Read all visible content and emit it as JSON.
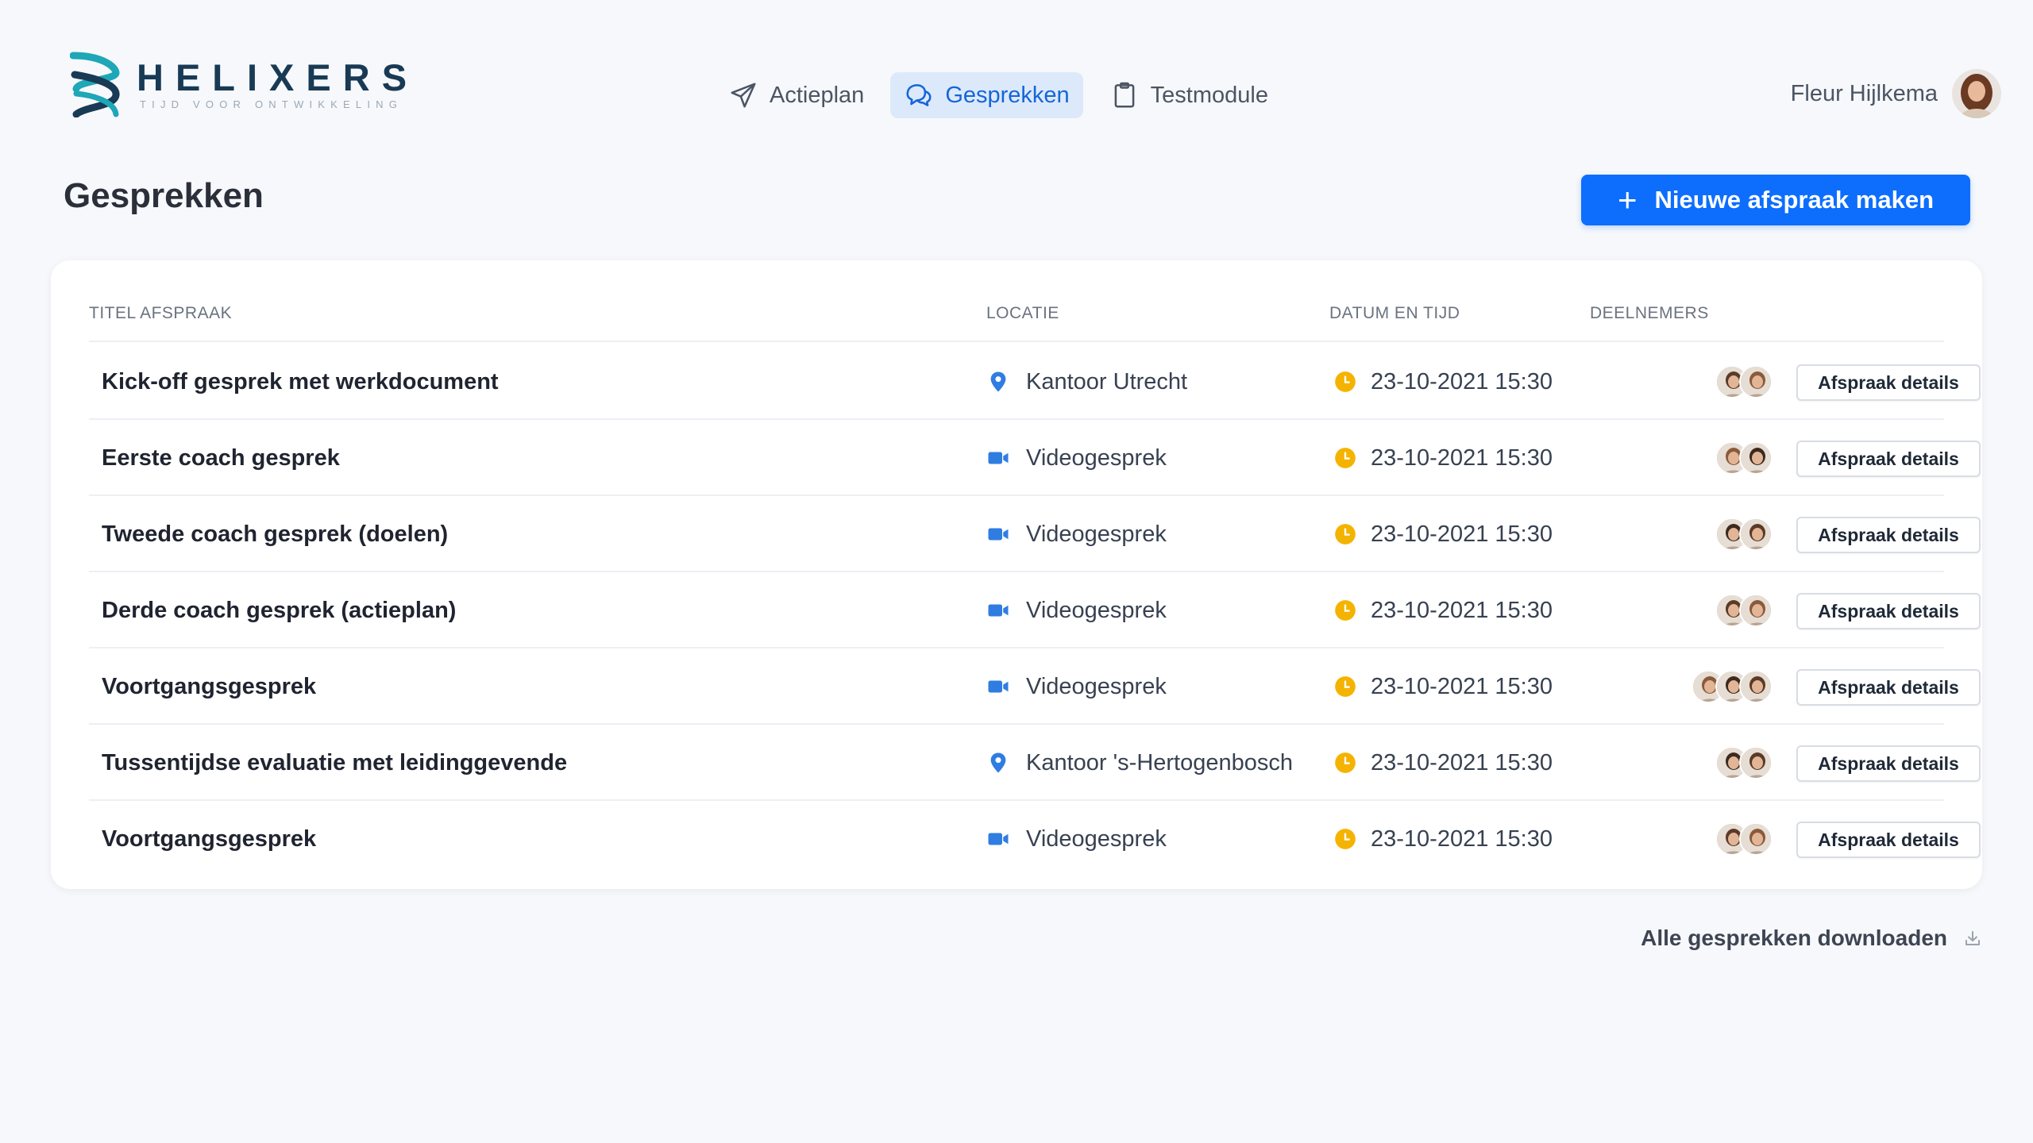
{
  "brand": {
    "name": "HELIXERS",
    "tagline": "TIJD VOOR ONTWIKKELING",
    "accent": "#0d6efd",
    "logo_teal": "#1ea7b7",
    "logo_navy": "#183a55"
  },
  "nav": {
    "items": [
      {
        "label": "Actieplan",
        "icon": "paper-plane-icon",
        "active": false
      },
      {
        "label": "Gesprekken",
        "icon": "chat-bubbles-icon",
        "active": true
      },
      {
        "label": "Testmodule",
        "icon": "clipboard-icon",
        "active": false
      }
    ]
  },
  "user": {
    "name": "Fleur Hijlkema"
  },
  "page": {
    "title": "Gesprekken",
    "new_button": "Nieuwe afspraak maken"
  },
  "table": {
    "headers": {
      "title": "TITEL AFSPRAAK",
      "location": "LOCATIE",
      "datetime": "DATUM EN TIJD",
      "participants": "DEELNEMERS"
    },
    "rows": [
      {
        "title": "Kick-off gesprek met werkdocument",
        "location": "Kantoor Utrecht",
        "location_type": "office",
        "datetime": "23-10-2021 15:30",
        "participants": 2,
        "action": "Afspraak details"
      },
      {
        "title": "Eerste coach gesprek",
        "location": "Videogesprek",
        "location_type": "video",
        "datetime": "23-10-2021 15:30",
        "participants": 2,
        "action": "Afspraak details"
      },
      {
        "title": "Tweede coach gesprek (doelen)",
        "location": "Videogesprek",
        "location_type": "video",
        "datetime": "23-10-2021 15:30",
        "participants": 2,
        "action": "Afspraak details"
      },
      {
        "title": "Derde coach gesprek (actieplan)",
        "location": "Videogesprek",
        "location_type": "video",
        "datetime": "23-10-2021 15:30",
        "participants": 2,
        "action": "Afspraak details"
      },
      {
        "title": "Voortgangsgesprek",
        "location": "Videogesprek",
        "location_type": "video",
        "datetime": "23-10-2021 15:30",
        "participants": 3,
        "action": "Afspraak details"
      },
      {
        "title": "Tussentijdse evaluatie met leidinggevende",
        "location": "Kantoor 's-Hertogenbosch",
        "location_type": "office",
        "datetime": "23-10-2021 15:30",
        "participants": 2,
        "action": "Afspraak details"
      },
      {
        "title": "Voortgangsgesprek",
        "location": "Videogesprek",
        "location_type": "video",
        "datetime": "23-10-2021 15:30",
        "participants": 2,
        "action": "Afspraak details"
      }
    ]
  },
  "footer": {
    "download_label": "Alle gesprekken downloaden"
  },
  "colors": {
    "icon_blue": "#2f7de1",
    "clock_yellow": "#f5b301"
  }
}
